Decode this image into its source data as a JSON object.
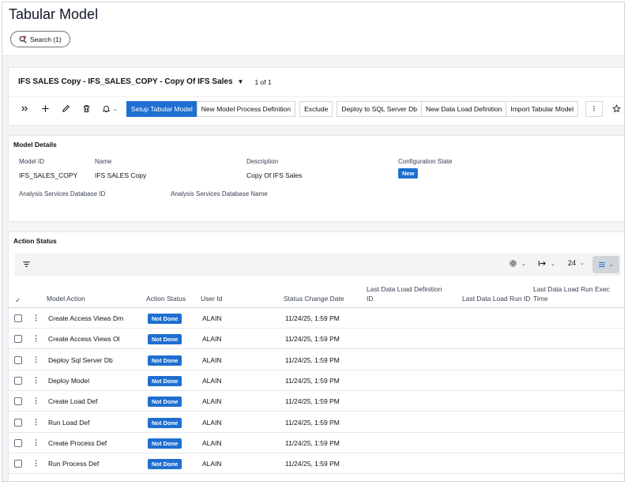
{
  "page_title": "Tabular Model",
  "search_label": "Search (1)",
  "record": {
    "title": "IFS SALES Copy - IFS_SALES_COPY - Copy Of IFS Sales",
    "count": "1 of 1"
  },
  "toolbar": {
    "buttons": [
      "Setup Tabular Model",
      "New Model Process Definition",
      "Exclude",
      "Deploy to SQL Server Db",
      "New Data Load Definition",
      "Import Tabular Model"
    ]
  },
  "details": {
    "title": "Model Details",
    "model_id_label": "Model ID",
    "model_id": "IFS_SALES_COPY",
    "name_label": "Name",
    "name": "IFS SALES Copy",
    "description_label": "Description",
    "description": "Copy Of IFS Sales",
    "config_state_label": "Configuration State",
    "config_state": "New",
    "as_db_id_label": "Analysis Services Database ID",
    "as_db_id": "",
    "as_db_name_label": "Analysis Services Database Name",
    "as_db_name": ""
  },
  "action_status": {
    "title": "Action Status",
    "page_size": "24",
    "columns": {
      "model_action": "Model Action",
      "action_status": "Action Status",
      "user_id": "User Id",
      "status_change_date": "Status Change Date",
      "last_dl_def_id": "Last Data Load Definition ID",
      "last_dl_run_id": "Last Data Load Run ID",
      "last_dl_run_exec_time": "Last Data Load Run Exec Time"
    },
    "rows": [
      {
        "action": "Create Access Views Dm",
        "status": "Not Done",
        "user": "ALAIN",
        "date": "11/24/25, 1:59 PM"
      },
      {
        "action": "Create Access Views Ol",
        "status": "Not Done",
        "user": "ALAIN",
        "date": "11/24/25, 1:59 PM"
      },
      {
        "action": "Deploy Sql Server Db",
        "status": "Not Done",
        "user": "ALAIN",
        "date": "11/24/25, 1:59 PM"
      },
      {
        "action": "Deploy Model",
        "status": "Not Done",
        "user": "ALAIN",
        "date": "11/24/25, 1:59 PM"
      },
      {
        "action": "Create Load Def",
        "status": "Not Done",
        "user": "ALAIN",
        "date": "11/24/25, 1:59 PM"
      },
      {
        "action": "Run Load Def",
        "status": "Not Done",
        "user": "ALAIN",
        "date": "11/24/25, 1:59 PM"
      },
      {
        "action": "Create Process Def",
        "status": "Not Done",
        "user": "ALAIN",
        "date": "11/24/25, 1:59 PM"
      },
      {
        "action": "Run Process Def",
        "status": "Not Done",
        "user": "ALAIN",
        "date": "11/24/25, 1:59 PM"
      }
    ]
  },
  "colors": {
    "primary": "#1f6fd0",
    "badge_text": "#ffffff"
  }
}
